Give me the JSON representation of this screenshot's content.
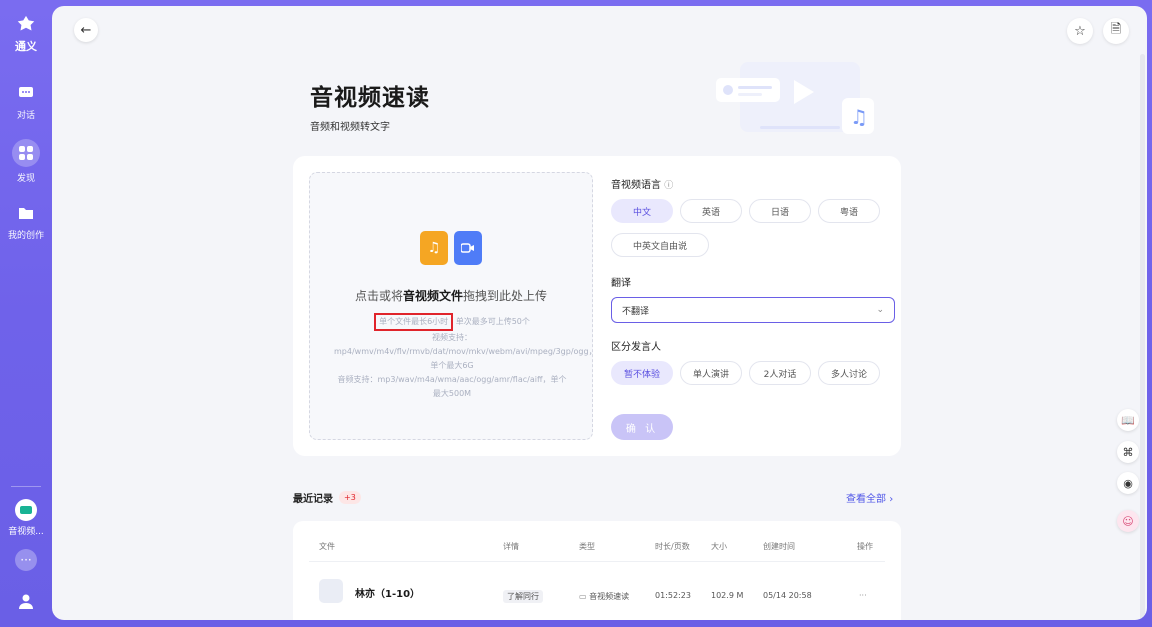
{
  "rail": {
    "logo_label": "通义",
    "items": [
      {
        "label": "对话",
        "icon": "chat-icon"
      },
      {
        "label": "发现",
        "icon": "grid-icon"
      },
      {
        "label": "我的创作",
        "icon": "folder-icon"
      }
    ],
    "app_label": "音视频...",
    "more_icon": "more-icon",
    "user_icon": "user-icon"
  },
  "page": {
    "title": "音视频速读",
    "subtitle": "音频和视频转文字"
  },
  "upload": {
    "main_prefix": "点击或将",
    "main_bold": "音视频文件",
    "main_suffix": "拖拽到此处上传",
    "hint_highlight": "单个文件最长6小时",
    "hint_rest": "单次最多可上传50个",
    "hint_video": "视频支持：mp4/wmv/m4v/flv/rmvb/dat/mov/mkv/webm/avi/mpeg/3gp/ogg，单个最大6G",
    "hint_audio": "音频支持：mp3/wav/m4a/wma/aac/ogg/amr/flac/aiff，单个最大500M"
  },
  "options": {
    "language_label": "音视频语言",
    "languages": [
      "中文",
      "英语",
      "日语",
      "粤语",
      "中英文自由说"
    ],
    "translate_label": "翻译",
    "translate_value": "不翻译",
    "speaker_label": "区分发言人",
    "speakers": [
      "暂不体验",
      "单人演讲",
      "2人对话",
      "多人讨论"
    ],
    "confirm_label": "确 认"
  },
  "recent": {
    "title": "最近记录",
    "badge": "+3",
    "view_all": "查看全部",
    "columns": [
      "文件",
      "详情",
      "类型",
      "时长/页数",
      "大小",
      "创建时间",
      "操作"
    ],
    "rows": [
      {
        "name": "林亦（1-10）",
        "detail": "了解同行",
        "type": "音视频速读",
        "duration": "01:52:23",
        "size": "102.9 M",
        "created": "05/14 20:58",
        "action": "···"
      }
    ]
  },
  "colors": {
    "accent": "#6a5fe6",
    "highlight_box": "#e0242b"
  }
}
